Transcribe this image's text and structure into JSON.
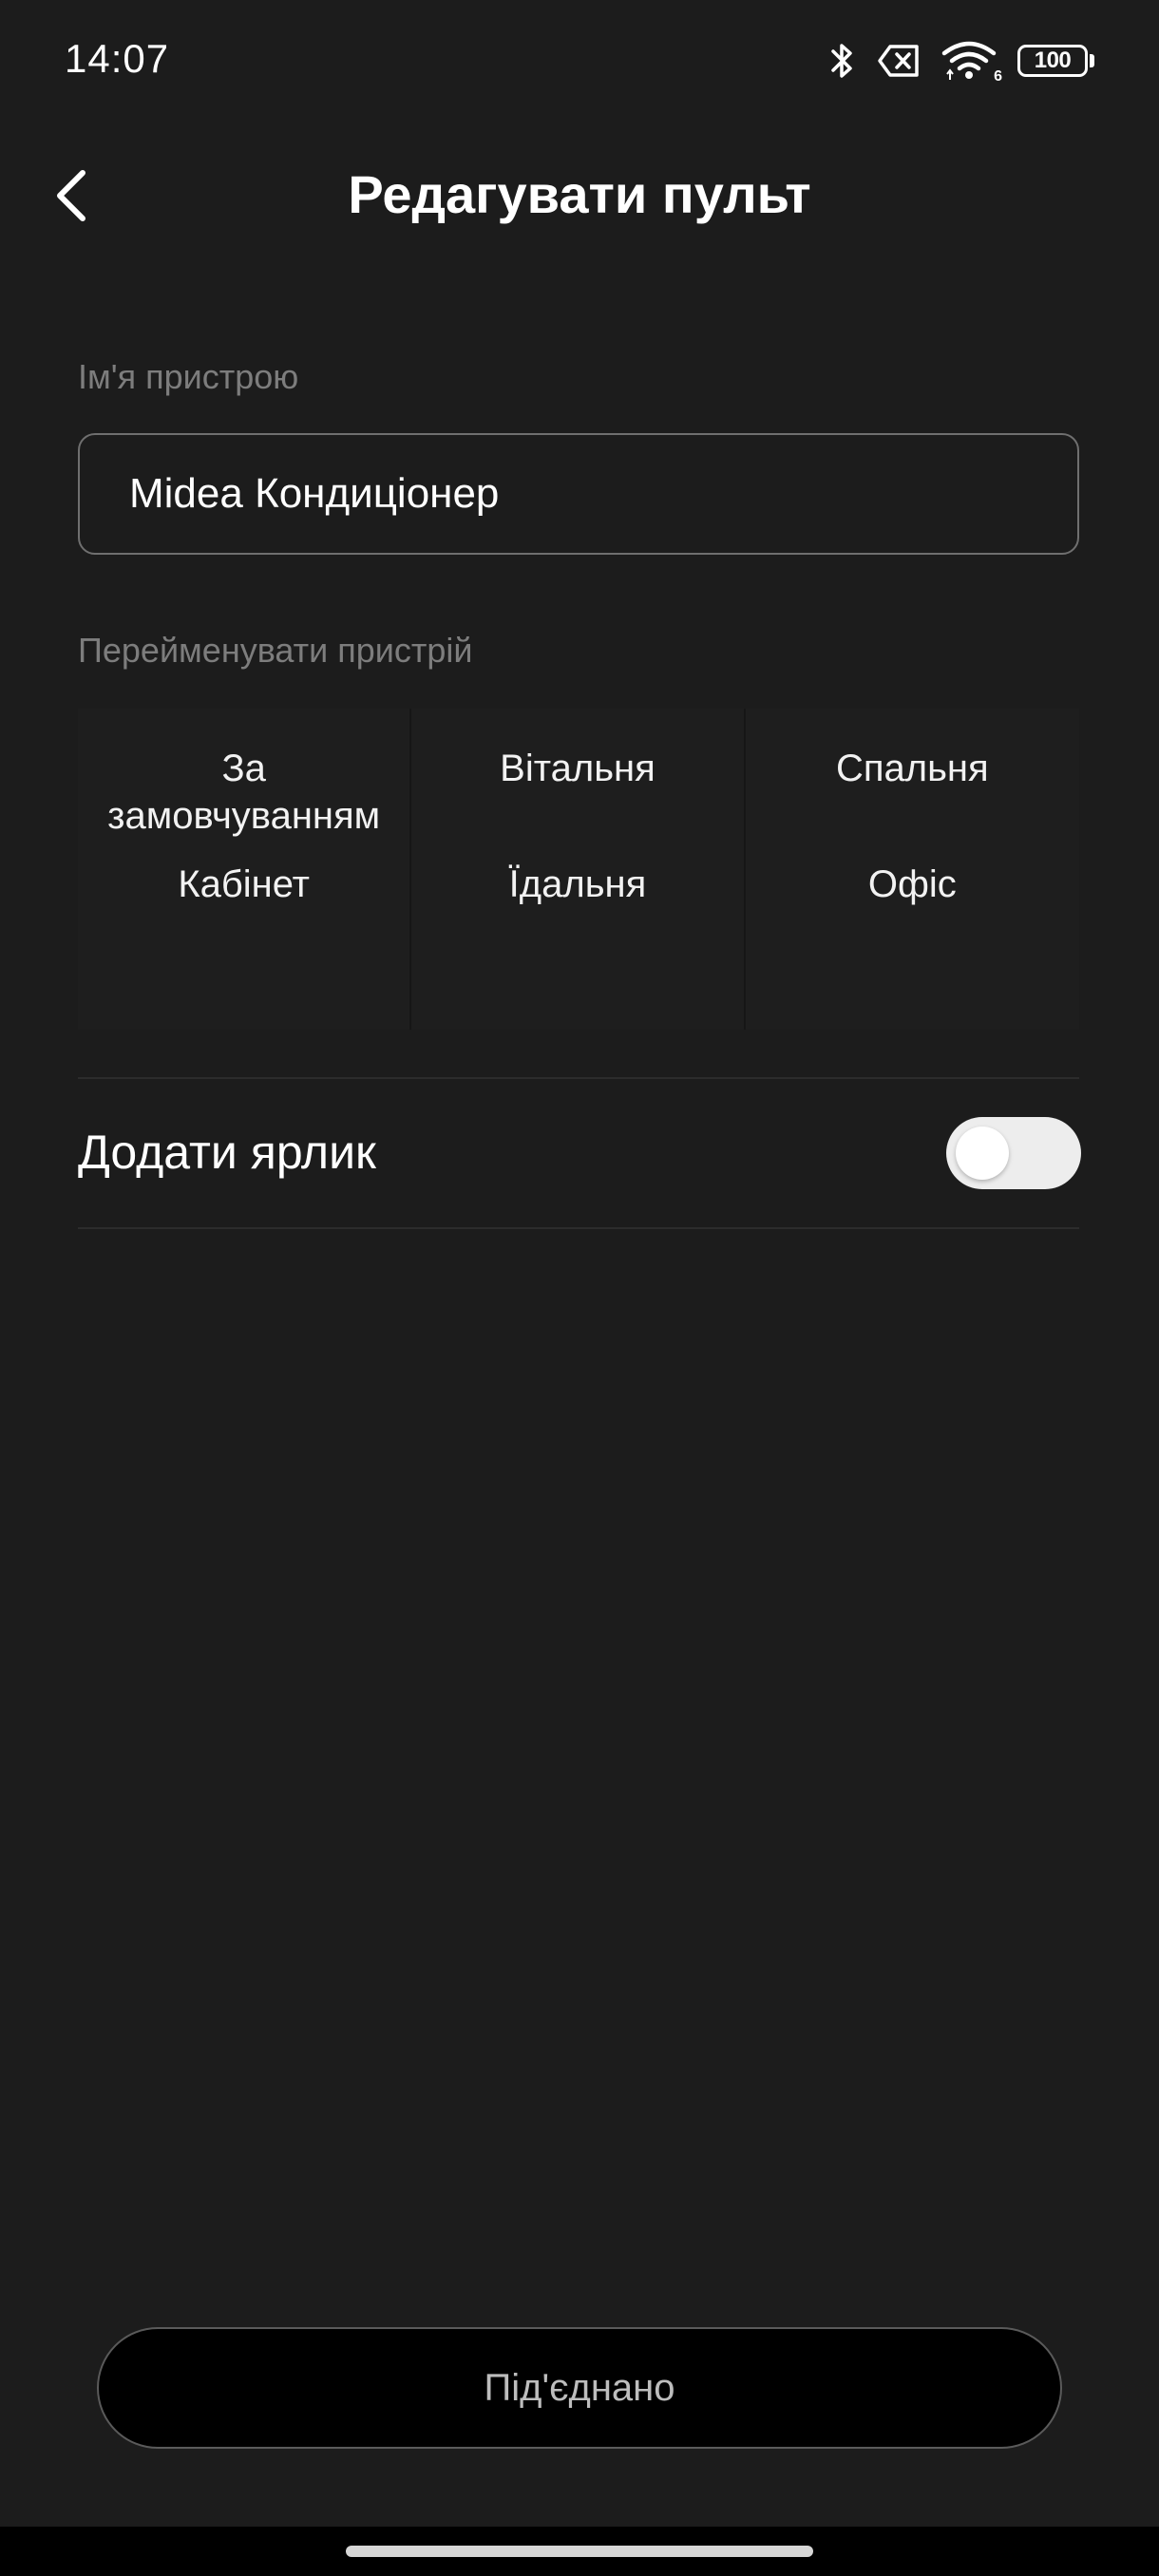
{
  "status_bar": {
    "time": "14:07",
    "battery_level": "100",
    "wifi_badge": "6",
    "icons": [
      "bluetooth-icon",
      "no-sim-icon",
      "wifi-icon",
      "battery-icon"
    ]
  },
  "header": {
    "title": "Редагувати пульт",
    "back_icon": "chevron-left-icon"
  },
  "device_name": {
    "label": "Ім'я пристрою",
    "value": "Midea Кондиціонер"
  },
  "rename": {
    "label": "Перейменувати пристрій",
    "options": [
      [
        "За",
        "замовчуванням"
      ],
      [
        "Вітальня"
      ],
      [
        "Спальня"
      ],
      [
        "Кабінет"
      ],
      [
        "Їдальня"
      ],
      [
        "Офіс"
      ]
    ]
  },
  "shortcut": {
    "label": "Додати ярлик",
    "enabled": false
  },
  "footer": {
    "connect_label": "Під'єднано"
  },
  "colors": {
    "background": "#1c1c1c",
    "toggle_track": "#ededed",
    "button_background": "#000000",
    "muted_text": "#7d7d7d"
  }
}
